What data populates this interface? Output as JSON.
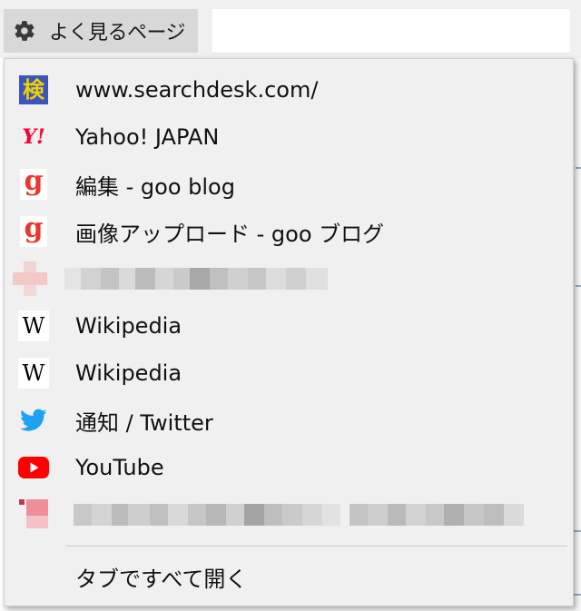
{
  "toolbar": {
    "button_label": "よく見るページ",
    "button_icon": "gear-icon"
  },
  "menu": {
    "items": [
      {
        "label": "www.searchdesk.com/",
        "icon": "kanji-search-favicon",
        "icon_text": "検"
      },
      {
        "label": "Yahoo! JAPAN",
        "icon": "yahoo-favicon",
        "icon_text": "Y!"
      },
      {
        "label": "編集 - goo blog",
        "icon": "goo-favicon",
        "icon_text": "g"
      },
      {
        "label": "画像アップロード - goo ブログ",
        "icon": "goo-favicon",
        "icon_text": "g"
      },
      {
        "label": "",
        "icon": "blurred-favicon"
      },
      {
        "label": "Wikipedia",
        "icon": "wikipedia-favicon",
        "icon_text": "W"
      },
      {
        "label": "Wikipedia",
        "icon": "wikipedia-favicon",
        "icon_text": "W"
      },
      {
        "label": "通知 / Twitter",
        "icon": "twitter-favicon"
      },
      {
        "label": "YouTube",
        "icon": "youtube-favicon"
      },
      {
        "label": "",
        "icon": "blurred-favicon"
      }
    ],
    "open_all_label": "タブですべて開く"
  },
  "colors": {
    "menu_bg": "#f0f0f0",
    "yahoo_red": "#ff0033",
    "goo_red": "#e8382f",
    "twitter_blue": "#1da1f2",
    "youtube_red": "#ff0000",
    "kanji_bg": "#3a55c0",
    "kanji_fg": "#f0d000"
  }
}
